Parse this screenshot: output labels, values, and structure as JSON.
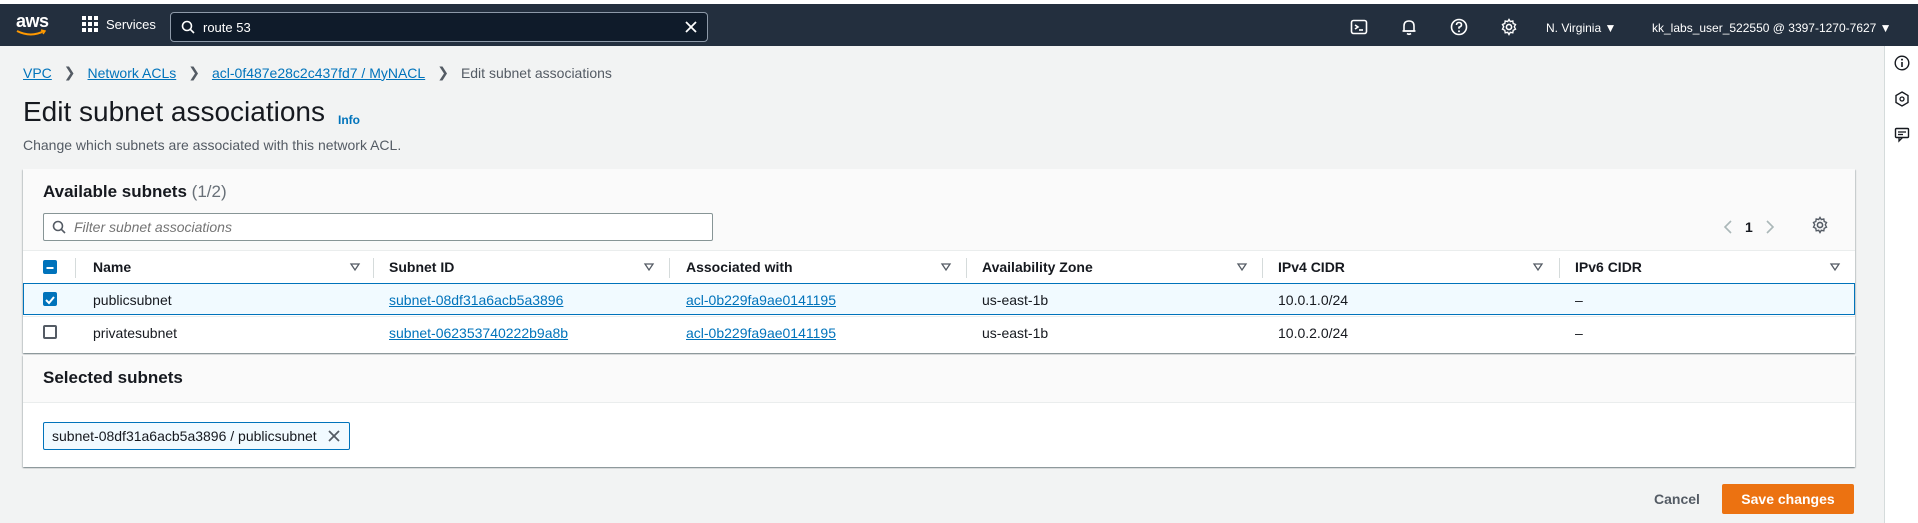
{
  "nav": {
    "logo_text": "aws",
    "services_label": "Services",
    "search_value": "route 53",
    "region": "N. Virginia ▼",
    "account": "kk_labs_user_522550 @ 3397-1270-7627 ▼"
  },
  "breadcrumb": {
    "items": [
      "VPC",
      "Network ACLs",
      "acl-0f487e28c2c437fd7 / MyNACL"
    ],
    "current": "Edit subnet associations"
  },
  "page": {
    "title": "Edit subnet associations",
    "info_link": "Info",
    "description": "Change which subnets are associated with this network ACL."
  },
  "available": {
    "title": "Available subnets",
    "count": "(1/2)",
    "filter_placeholder": "Filter subnet associations",
    "page_number": "1",
    "columns": [
      "Name",
      "Subnet ID",
      "Associated with",
      "Availability Zone",
      "IPv4 CIDR",
      "IPv6 CIDR"
    ],
    "rows": [
      {
        "checked": true,
        "name": "publicsubnet",
        "subnet_id": "subnet-08df31a6acb5a3896",
        "associated_with": "acl-0b229fa9ae0141195",
        "az": "us-east-1b",
        "ipv4": "10.0.1.0/24",
        "ipv6": "–"
      },
      {
        "checked": false,
        "name": "privatesubnet",
        "subnet_id": "subnet-062353740222b9a8b",
        "associated_with": "acl-0b229fa9ae0141195",
        "az": "us-east-1b",
        "ipv4": "10.0.2.0/24",
        "ipv6": "–"
      }
    ]
  },
  "selected": {
    "title": "Selected subnets",
    "tokens": [
      "subnet-08df31a6acb5a3896 / publicsubnet"
    ]
  },
  "actions": {
    "cancel": "Cancel",
    "save": "Save changes"
  },
  "colors": {
    "nav_bg": "#232f3e",
    "link": "#0073bb",
    "primary_button": "#ec7211",
    "selected_row": "#f1faff"
  }
}
